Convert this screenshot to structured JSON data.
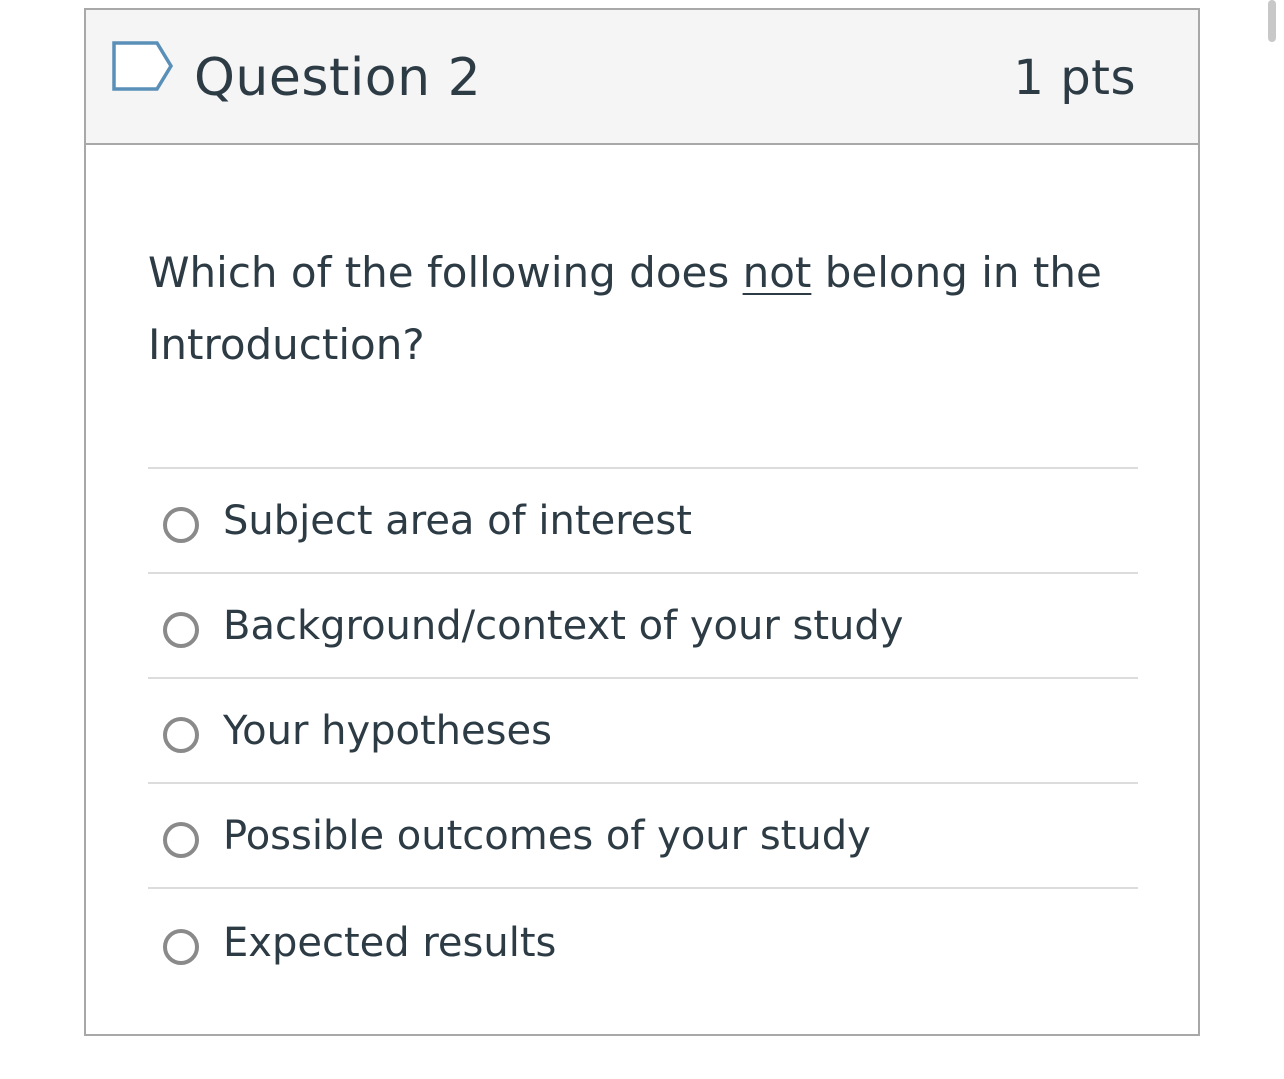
{
  "question": {
    "title": "Question 2",
    "points": "1 pts",
    "flag_icon": "flag-bookmark-icon",
    "text_before": "Which of the following does ",
    "text_emphasis": "not",
    "text_after": " belong in the Introduction?"
  },
  "answers": [
    {
      "label": "Subject area of interest",
      "selected": false
    },
    {
      "label": "Background/context of your study",
      "selected": false
    },
    {
      "label": "Your hypotheses",
      "selected": false
    },
    {
      "label": "Possible outcomes of your study",
      "selected": false
    },
    {
      "label": "Expected results",
      "selected": false
    }
  ],
  "colors": {
    "text": "#2d3b45",
    "border": "#a8a8a8",
    "header_bg": "#f5f5f5",
    "divider": "#dcdcdc",
    "radio": "#8a8a8a",
    "flag": "#5a8fb8"
  }
}
